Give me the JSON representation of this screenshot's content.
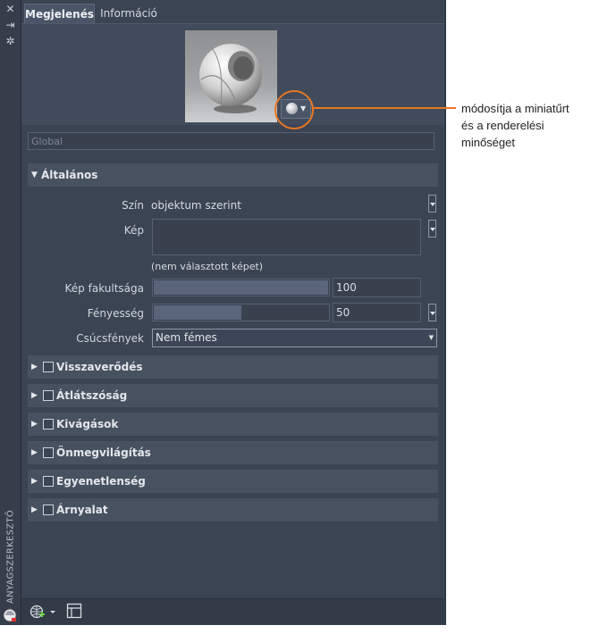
{
  "palette": {
    "title": "ANYAGSZERKESZTŐ"
  },
  "tabs": [
    {
      "label": "Megjelenés",
      "active": true
    },
    {
      "label": "Információ",
      "active": false
    }
  ],
  "name_field": {
    "placeholder": "Global"
  },
  "general": {
    "title": "Általános",
    "color_label": "Szín",
    "color_value": "objektum szerint",
    "image_label": "Kép",
    "image_caption": "(nem választott képet)",
    "fade_label": "Kép fakultsága",
    "fade_value": "100",
    "fade_level": 1.0,
    "gloss_label": "Fényesség",
    "gloss_value": "50",
    "gloss_level": 0.5,
    "highlights_label": "Csúcsfények",
    "highlights_value": "Nem fémes"
  },
  "sections": [
    "Visszaverődés",
    "Átlátszóság",
    "Kivágások",
    "Önmegvilágítás",
    "Egyenetlenség",
    "Árnyalat"
  ],
  "callout": {
    "line1": "módosítja a miniatűrt",
    "line2": "és a renderelési",
    "line3": "minőséget"
  },
  "colors": {
    "accent": "#e87722",
    "panel": "#3b4453"
  }
}
